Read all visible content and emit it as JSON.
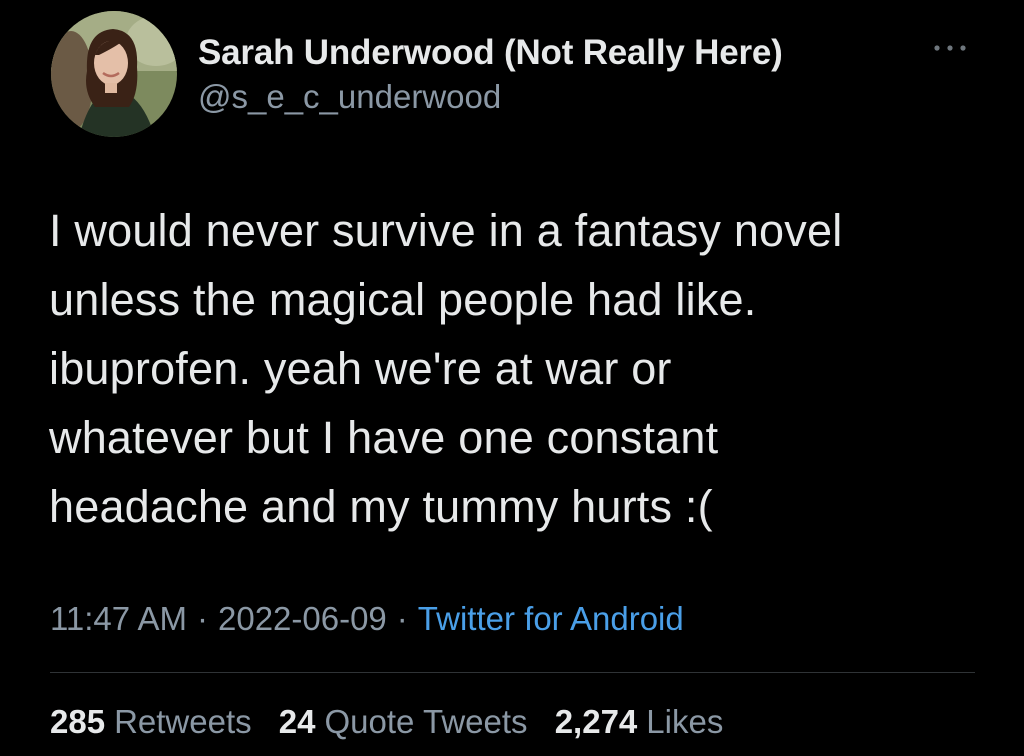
{
  "user": {
    "display_name": "Sarah Underwood (Not Really Here)",
    "handle": "@s_e_c_underwood",
    "avatar_icon": "profile-photo"
  },
  "tweet": {
    "text": "I would never survive in a fantasy novel\nunless the magical people had like.\nibuprofen. yeah we're at war or\nwhatever but I have one constant\nheadache and my tummy hurts :("
  },
  "meta": {
    "time": "11:47 AM",
    "separator": "·",
    "date": "2022-06-09",
    "source": "Twitter for Android"
  },
  "stats": {
    "retweets_count": "285",
    "retweets_label": "Retweets",
    "quotes_count": "24",
    "quotes_label": "Quote Tweets",
    "likes_count": "2,274",
    "likes_label": "Likes"
  },
  "colors": {
    "background": "#000000",
    "text": "#e7e9ea",
    "secondary_text": "#8b98a5",
    "link": "#4a9fe8",
    "divider": "#2f3336"
  },
  "icons": {
    "more": "more-horizontal-icon"
  }
}
